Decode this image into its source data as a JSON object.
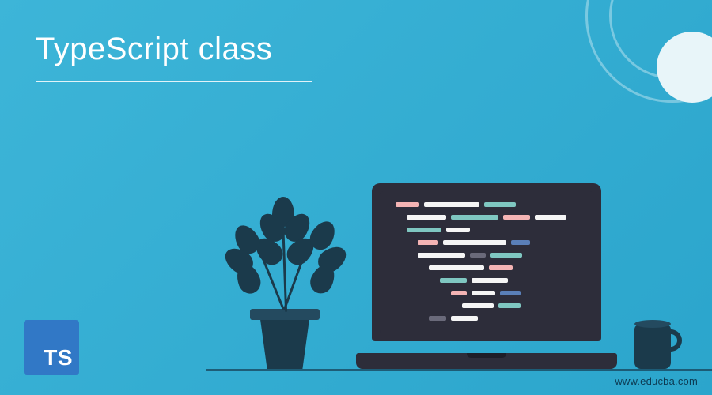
{
  "title": "TypeScript class",
  "ts_badge_label": "TS",
  "website_url": "www.educba.com",
  "colors": {
    "background_start": "#3db5d8",
    "background_end": "#2ba5cc",
    "dark_navy": "#1b3a4b",
    "ts_blue": "#3178c6",
    "screen_bg": "#2d2d3a"
  },
  "icons": {
    "badge": "typescript-logo",
    "plant": "potted-plant",
    "laptop": "laptop-with-code",
    "mug": "coffee-mug"
  }
}
